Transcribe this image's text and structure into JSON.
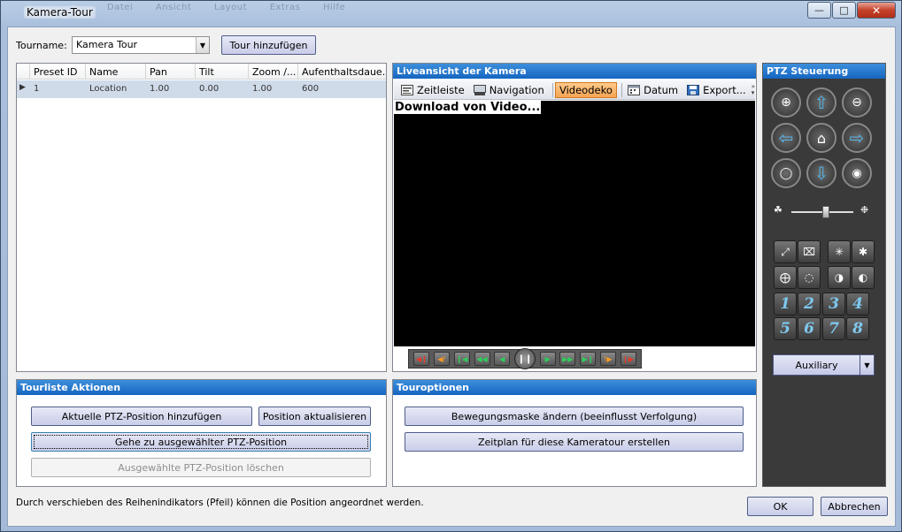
{
  "window": {
    "title": "Kamera-Tour",
    "ghost_menu": [
      "Datei",
      "Ansicht",
      "Layout",
      "Extras",
      "Hilfe"
    ],
    "minimize_icon": "minimize-icon",
    "maximize_icon": "maximize-icon",
    "close_icon": "close-icon"
  },
  "top": {
    "tourname_label": "Tourname:",
    "tourname_value": "Kamera Tour",
    "add_tour_button": "Tour hinzufügen"
  },
  "grid": {
    "columns": [
      "Preset ID",
      "Name",
      "Pan",
      "Tilt",
      "Zoom /...",
      "Aufenthaltsdaue..."
    ],
    "rows": [
      {
        "id": "1",
        "name": "Location",
        "pan": "1.00",
        "tilt": "0.00",
        "zoom": "1.00",
        "stay": "600"
      }
    ]
  },
  "live": {
    "header": "Liveansicht der Kamera",
    "toolbar": [
      {
        "label": "Zeitleiste",
        "icon": "timeline-icon"
      },
      {
        "label": "Navigation",
        "icon": "navigation-icon"
      },
      {
        "label": "Videodeko",
        "icon": "",
        "active": true
      },
      {
        "label": "Datum",
        "icon": "calendar-icon"
      },
      {
        "label": "Export...",
        "icon": "save-icon"
      }
    ],
    "overlay_text": "Download von Video..."
  },
  "ptz": {
    "header": "PTZ Steuerung",
    "presets": [
      "1",
      "2",
      "3",
      "4",
      "5",
      "6",
      "7",
      "8"
    ],
    "aux_label": "Auxiliary",
    "speed_level": 0.55
  },
  "tourlist_actions": {
    "header": "Tourliste Aktionen",
    "add_current": "Aktuelle PTZ-Position hinzufügen",
    "update_position": "Position aktualisieren",
    "goto_selected": "Gehe zu ausgewählter PTZ-Position",
    "delete_selected": "Ausgewählte PTZ-Position löschen"
  },
  "tour_options": {
    "header": "Touroptionen",
    "motion_mask": "Bewegungsmaske ändern (beeinflusst Verfolgung)",
    "schedule": "Zeitplan für diese Kameratour erstellen"
  },
  "footer": {
    "status": "Durch verschieben des Reihenindikators (Pfeil) können die Position angeordnet werden.",
    "ok": "OK",
    "cancel": "Abbrechen"
  },
  "colors": {
    "panel_header": "#1565c0",
    "active_tab": "#f6a454",
    "ptz_arrow": "#55b6e8"
  }
}
